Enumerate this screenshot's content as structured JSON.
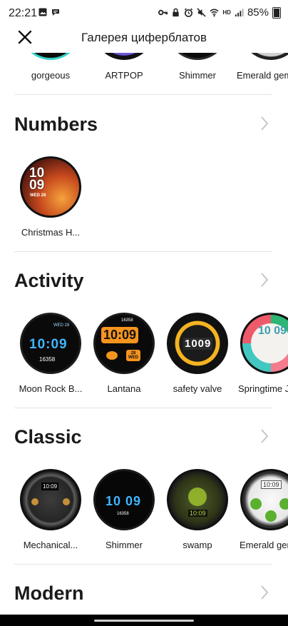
{
  "status_bar": {
    "time": "22:21",
    "battery_text": "85%",
    "network_label": "HD",
    "icons_left": [
      "image-icon",
      "chat-icon"
    ],
    "icons_right": [
      "key-icon",
      "lock-icon",
      "alarm-icon",
      "mute-icon",
      "wifi-icon",
      "signal-icon",
      "battery-icon"
    ]
  },
  "app_bar": {
    "title": "Галерея циферблатов"
  },
  "top_row": {
    "items": [
      "gorgeous",
      "ARTPOP",
      "Shimmer",
      "Emerald gem"
    ]
  },
  "sections": [
    {
      "title": "Numbers",
      "faces": [
        {
          "label": "Christmas H...",
          "time_text": "10\n09",
          "date_text": "WED 28"
        }
      ]
    },
    {
      "title": "Activity",
      "faces": [
        {
          "label": "Moon Rock B...",
          "time_text": "10:09",
          "date_text": "WED 28",
          "steps_text": "16358"
        },
        {
          "label": "Lantana",
          "time_text": "10:09",
          "date_text": "28 WED",
          "steps_text": "16358"
        },
        {
          "label": "safety valve",
          "time_text": "1009"
        },
        {
          "label": "Springtime J...",
          "time_text": "10 09"
        }
      ]
    },
    {
      "title": "Classic",
      "faces": [
        {
          "label": "Mechanical...",
          "time_text": "10:09"
        },
        {
          "label": "Shimmer",
          "time_text": "10 09",
          "steps_text": "16358"
        },
        {
          "label": "swamp",
          "time_text": "10:09"
        },
        {
          "label": "Emerald gem",
          "time_text": "10:09"
        }
      ]
    },
    {
      "title": "Modern",
      "faces": []
    }
  ],
  "colors": {
    "divider": "#e4e4e4",
    "chevron": "#c6c6c6",
    "text": "#1a1a1a"
  }
}
